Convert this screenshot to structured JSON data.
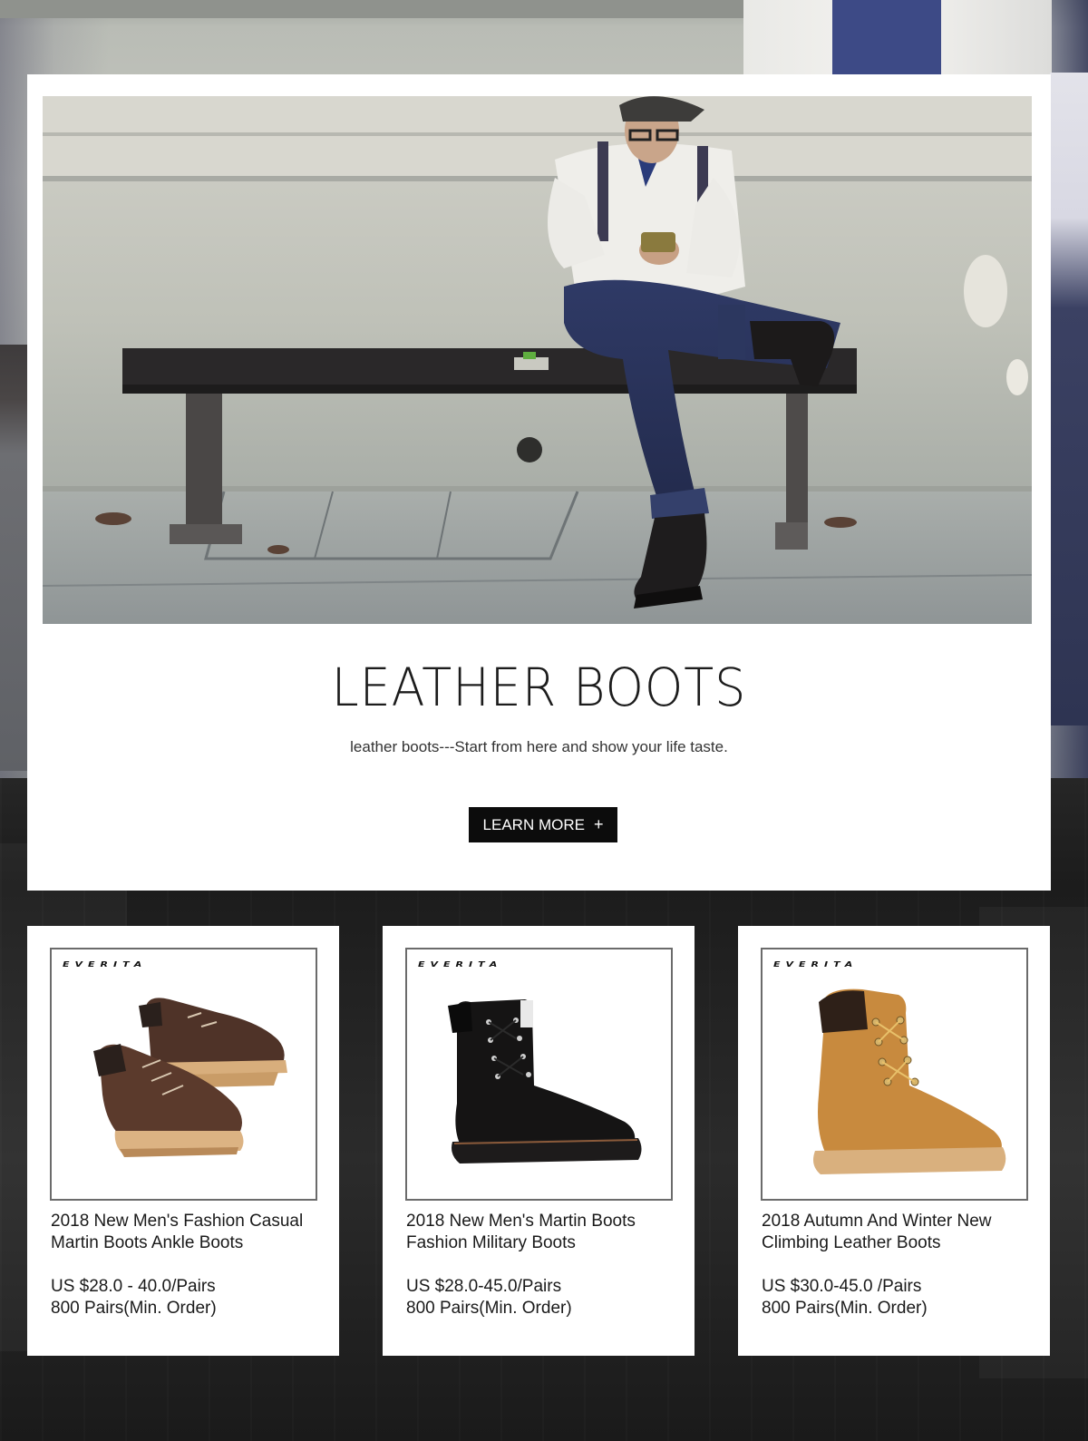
{
  "hero": {
    "title": "LEATHER BOOTS",
    "subtitle": "leather boots---Start from here and show your life taste.",
    "button_label": "LEARN MORE",
    "button_icon": "plus-icon",
    "button_icon_glyph": "+"
  },
  "products": [
    {
      "brand": "EVERITA",
      "title_line1": "2018 New Men's Fashion Casual",
      "title_line2": "Martin Boots Ankle Boots",
      "price": "US $28.0 - 40.0/Pairs",
      "moq": "800 Pairs(Min. Order)"
    },
    {
      "brand": "EVERITA",
      "title_line1": "2018 New Men's Martin Boots",
      "title_line2": "Fashion Military Boots",
      "price": "US $28.0-45.0/Pairs",
      "moq": "800 Pairs(Min. Order)"
    },
    {
      "brand": "EVERITA",
      "title_line1": "2018 Autumn And Winter New",
      "title_line2": "Climbing Leather Boots",
      "price": "US $30.0-45.0 /Pairs",
      "moq": "800 Pairs(Min. Order)"
    }
  ],
  "colors": {
    "button_bg": "#0c0c0c",
    "card_bg": "#ffffff",
    "page_bg_dark": "#1f1f1f",
    "boot_brown": "#5a3a2c",
    "boot_black": "#141414",
    "boot_tan": "#c88a3e",
    "sole_tan": "#d9b07e"
  }
}
